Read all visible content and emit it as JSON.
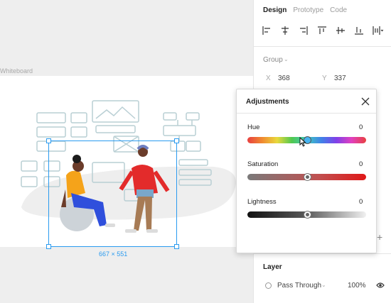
{
  "canvas": {
    "frame_label": "Whiteboard",
    "selection_size": "667 × 551"
  },
  "panel": {
    "tabs": [
      {
        "label": "Design",
        "active": true
      },
      {
        "label": "Prototype",
        "active": false
      },
      {
        "label": "Code",
        "active": false
      }
    ],
    "align_icons": [
      "align-left-icon",
      "align-horizontal-center-icon",
      "align-right-icon",
      "align-top-icon",
      "align-vertical-center-icon",
      "align-bottom-icon",
      "distribute-icon"
    ],
    "group_label": "Group",
    "x_label": "X",
    "x_value": "368",
    "y_label": "Y",
    "y_value": "337",
    "layer_title": "Layer",
    "blend_mode": "Pass Through",
    "opacity": "100%"
  },
  "adjustments": {
    "title": "Adjustments",
    "hue": {
      "label": "Hue",
      "value": "0",
      "position": 0.5
    },
    "saturation": {
      "label": "Saturation",
      "value": "0",
      "position": 0.5
    },
    "lightness": {
      "label": "Lightness",
      "value": "0",
      "position": 0.5
    }
  },
  "colors": {
    "selection": "#2a9bf0",
    "hue_thumb_fill": "#46b4f0"
  }
}
